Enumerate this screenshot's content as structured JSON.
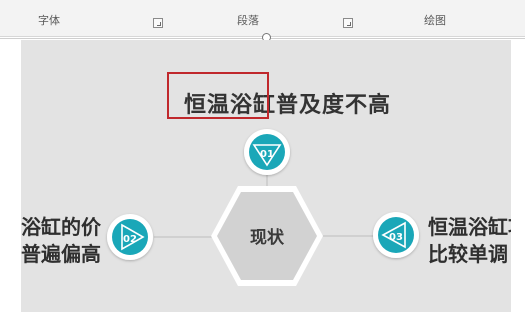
{
  "ribbon": {
    "groups": [
      "字体",
      "段落",
      "绘图"
    ]
  },
  "slide": {
    "title": "恒温浴缸普及度不高",
    "center_label": "现状",
    "badges": [
      "01",
      "02",
      "03"
    ],
    "left_text": [
      "浴缸的价",
      "普遍偏高"
    ],
    "right_text": [
      "恒温浴缸功",
      "比较单调"
    ]
  },
  "colors": {
    "accent": "#1aa7b8",
    "selection": "#c0282c",
    "slide_bg": "#e3e3e3",
    "hexagon": "#d2d2d2"
  },
  "icons": [
    "triangle-down-icon",
    "triangle-right-icon",
    "triangle-left-icon"
  ]
}
